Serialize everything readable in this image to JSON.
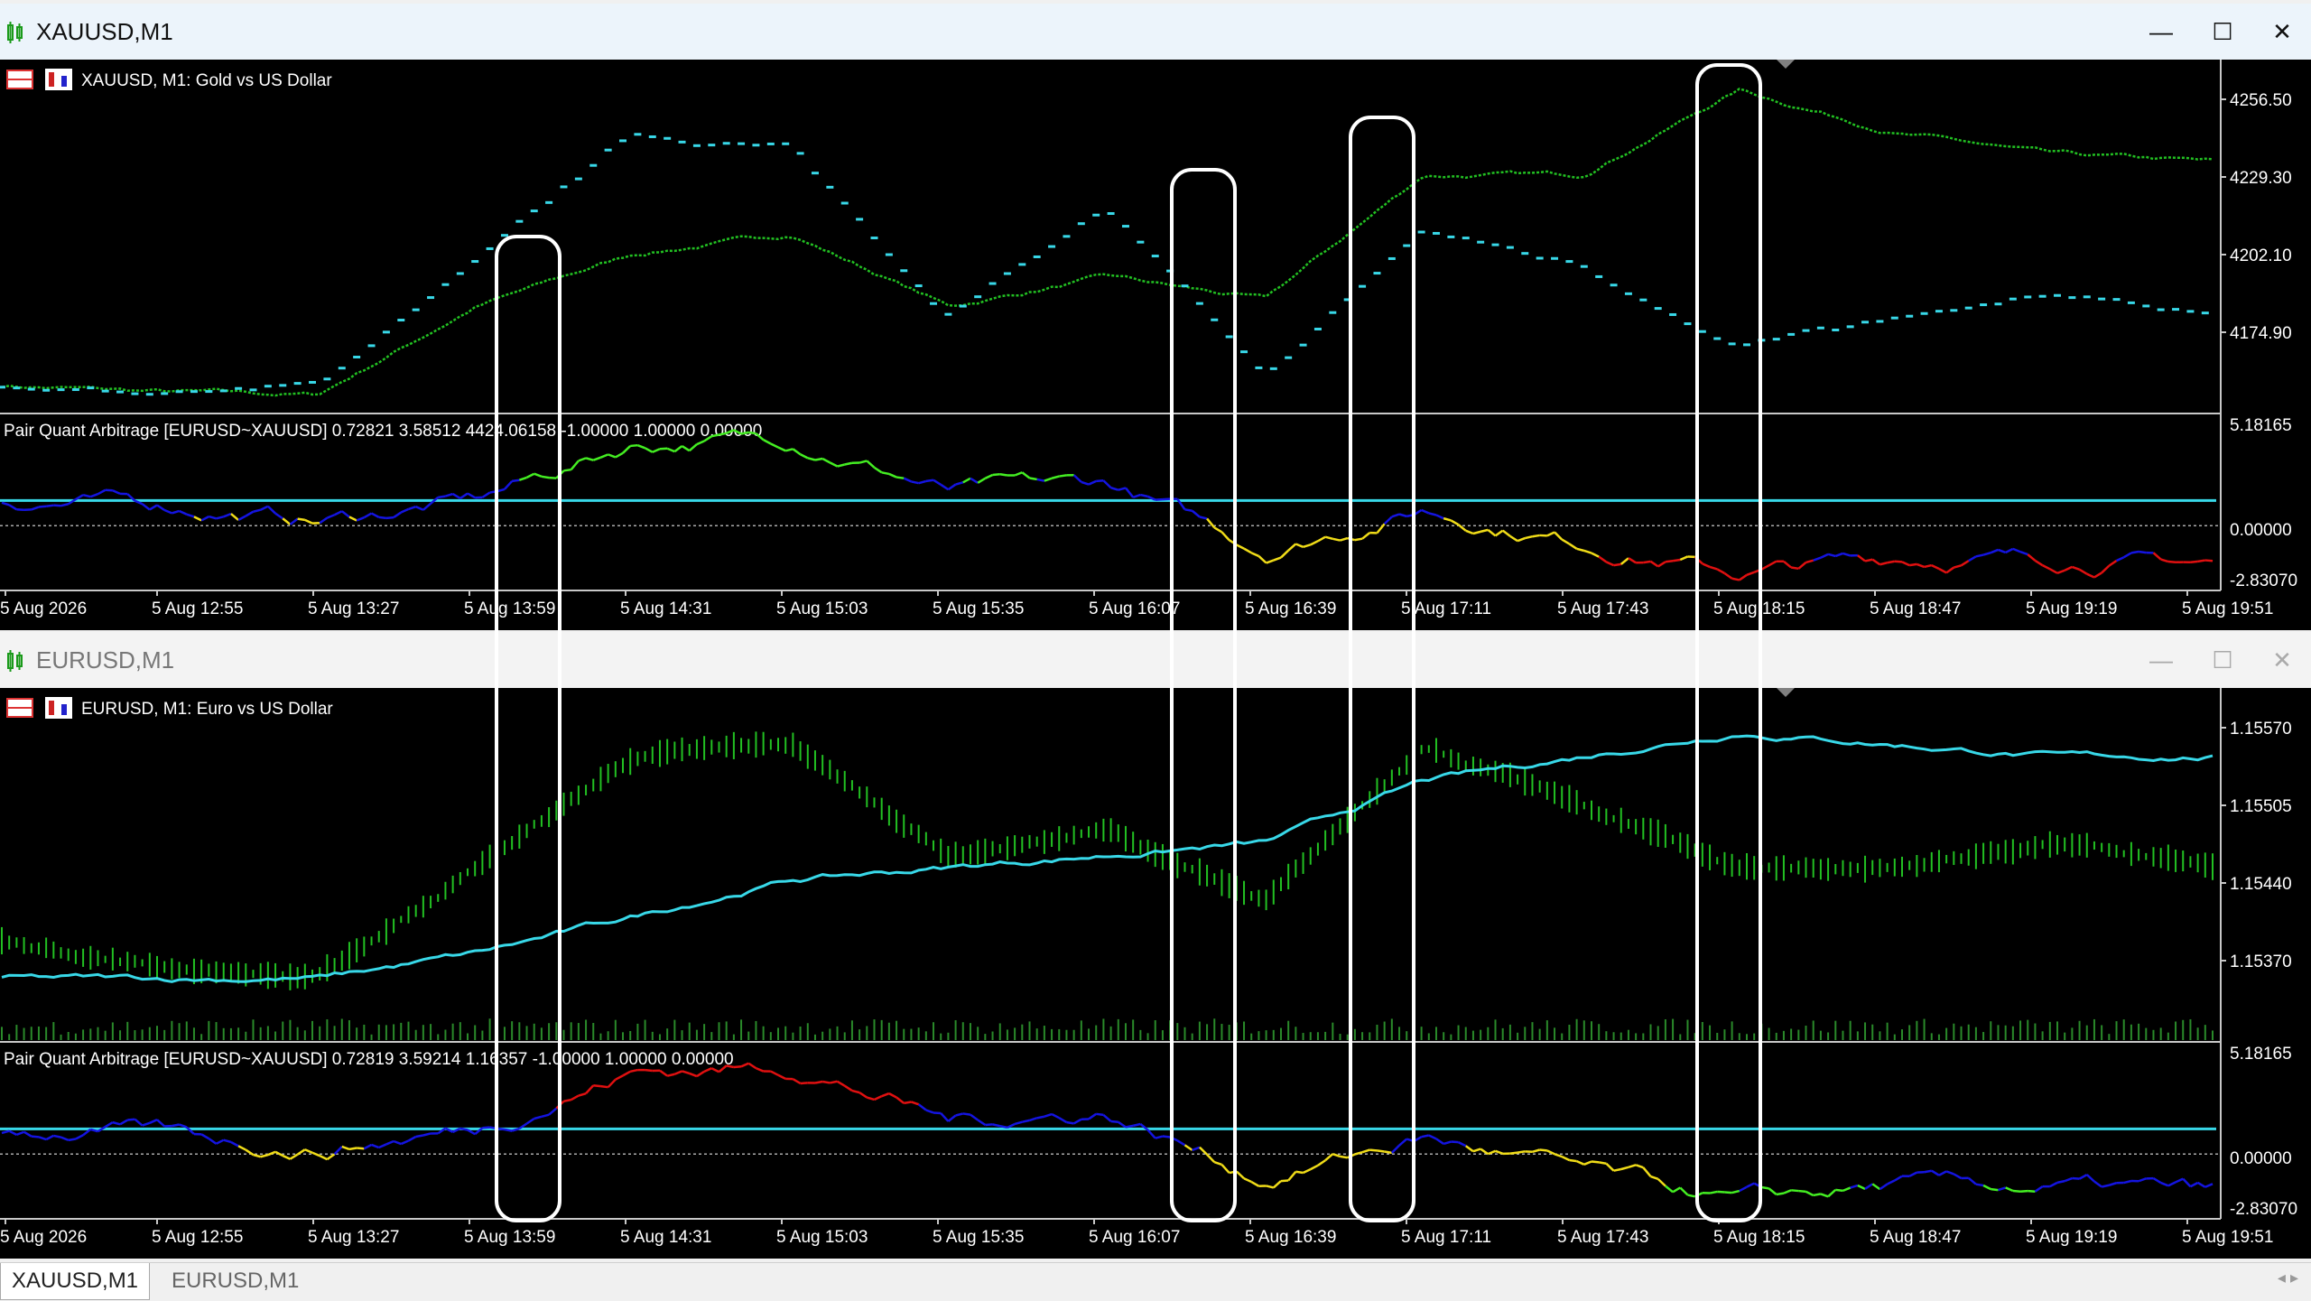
{
  "windows": [
    {
      "id": "w1",
      "title": "XAUUSD,M1",
      "chart_label": "XAUUSD, M1:  Gold vs US Dollar",
      "price_ticks": [
        "4256.50",
        "4229.30",
        "4202.10",
        "4174.90"
      ],
      "ind_label": "Pair Quant Arbitrage [EURUSD~XAUUSD] 0.72821 3.58512 4424.06158 -1.00000 1.00000 0.00000",
      "ind_ticks": [
        "5.18165",
        "0.00000",
        "-2.83070"
      ],
      "time_ticks": [
        "5 Aug 2026",
        "5 Aug 12:55",
        "5 Aug 13:27",
        "5 Aug 13:59",
        "5 Aug 14:31",
        "5 Aug 15:03",
        "5 Aug 15:35",
        "5 Aug 16:07",
        "5 Aug 16:39",
        "5 Aug 17:11",
        "5 Aug 17:43",
        "5 Aug 18:15",
        "5 Aug 18:47",
        "5 Aug 19:19",
        "5 Aug 19:51"
      ]
    },
    {
      "id": "w2",
      "title": "EURUSD,M1",
      "chart_label": "EURUSD, M1:  Euro vs US Dollar",
      "price_ticks": [
        "1.15570",
        "1.15505",
        "1.15440",
        "1.15370"
      ],
      "ind_label": "Pair Quant Arbitrage [EURUSD~XAUUSD] 0.72819 3.59214 1.16357 -1.00000 1.00000 0.00000",
      "ind_ticks": [
        "5.18165",
        "0.00000",
        "-2.83070"
      ],
      "time_ticks": [
        "5 Aug 2026",
        "5 Aug 12:55",
        "5 Aug 13:27",
        "5 Aug 13:59",
        "5 Aug 14:31",
        "5 Aug 15:03",
        "5 Aug 15:35",
        "5 Aug 16:07",
        "5 Aug 16:39",
        "5 Aug 17:11",
        "5 Aug 17:43",
        "5 Aug 18:15",
        "5 Aug 18:47",
        "5 Aug 19:19",
        "5 Aug 19:51"
      ]
    }
  ],
  "tabs": [
    {
      "label": "XAUUSD,M1",
      "active": true
    },
    {
      "label": "EURUSD,M1",
      "active": false
    }
  ],
  "title_buttons": {
    "minimize": "—",
    "maximize": "☐",
    "close": "✕"
  },
  "colors": {
    "green": "#22c022",
    "cyan": "#38d8e8",
    "blue": "#1414e0",
    "yellow": "#f0dc18",
    "red": "#e01010",
    "lime": "#44ee22"
  },
  "chart_data": [
    {
      "type": "line",
      "symbol": "XAUUSD",
      "timeframe": "M1",
      "title": "XAUUSD, M1:  Gold vs US Dollar",
      "x": [
        "5 Aug 2026",
        "5 Aug 12:55",
        "5 Aug 13:27",
        "5 Aug 13:59",
        "5 Aug 14:31",
        "5 Aug 15:03",
        "5 Aug 15:35",
        "5 Aug 16:07",
        "5 Aug 16:39",
        "5 Aug 17:11",
        "5 Aug 17:43",
        "5 Aug 18:15",
        "5 Aug 18:47",
        "5 Aug 19:19",
        "5 Aug 19:51"
      ],
      "series": [
        {
          "values": [
            4168,
            4166,
            4165,
            4192,
            4208,
            4214,
            4192,
            4201,
            4194,
            4232,
            4232,
            4258,
            4245,
            4238,
            4236
          ]
        },
        {
          "values": [
            4167,
            4166,
            4168,
            4205,
            4245,
            4240,
            4190,
            4222,
            4170,
            4215,
            4205,
            4180,
            4188,
            4195,
            4190
          ]
        }
      ],
      "ylim": [
        4160,
        4265
      ]
    },
    {
      "type": "line",
      "title": "Pair Quant Arbitrage [EURUSD~XAUUSD] 0.72821 3.58512 4424.06158 -1.00000 1.00000 0.00000",
      "x": [
        "5 Aug 2026",
        "5 Aug 12:55",
        "5 Aug 13:27",
        "5 Aug 13:59",
        "5 Aug 14:31",
        "5 Aug 15:03",
        "5 Aug 15:35",
        "5 Aug 16:07",
        "5 Aug 16:39",
        "5 Aug 17:11",
        "5 Aug 17:43",
        "5 Aug 18:15",
        "5 Aug 18:47",
        "5 Aug 19:19",
        "5 Aug 19:51"
      ],
      "series": [
        {
          "values": [
            1.2,
            1.0,
            0.2,
            1.2,
            3.9,
            4.2,
            1.6,
            2.0,
            -1.2,
            0.8,
            -0.8,
            -2.3,
            -1.5,
            -1.6,
            -1.8
          ]
        },
        {
          "values": [
            1.2,
            1.2,
            1.2,
            1.2,
            1.2,
            1.2,
            1.2,
            1.2,
            1.2,
            1.2,
            1.2,
            1.2,
            1.2,
            1.2,
            1.2
          ]
        }
      ],
      "ylim": [
        -2.8307,
        5.18165
      ]
    },
    {
      "type": "bar",
      "symbol": "EURUSD",
      "timeframe": "M1",
      "title": "EURUSD, M1:  Euro vs US Dollar",
      "x": [
        "5 Aug 2026",
        "5 Aug 12:55",
        "5 Aug 13:27",
        "5 Aug 13:59",
        "5 Aug 14:31",
        "5 Aug 15:03",
        "5 Aug 15:35",
        "5 Aug 16:07",
        "5 Aug 16:39",
        "5 Aug 17:11",
        "5 Aug 17:43",
        "5 Aug 18:15",
        "5 Aug 18:47",
        "5 Aug 19:19",
        "5 Aug 19:51"
      ],
      "series": [
        {
          "values": [
            1.154,
            1.1538,
            1.1537,
            1.1546,
            1.1555,
            1.1556,
            1.1547,
            1.1549,
            1.1543,
            1.1556,
            1.1551,
            1.1546,
            1.1546,
            1.1548,
            1.1546
          ]
        },
        {
          "values": [
            1.1537,
            1.1537,
            1.1537,
            1.1539,
            1.1542,
            1.1545,
            1.1546,
            1.1547,
            1.1548,
            1.1553,
            1.1555,
            1.1557,
            1.1556,
            1.1555,
            1.1555
          ]
        }
      ],
      "ylim": [
        1.1532,
        1.156
      ]
    },
    {
      "type": "line",
      "title": "Pair Quant Arbitrage [EURUSD~XAUUSD] 0.72819 3.59214 1.16357 -1.00000 1.00000 0.00000",
      "x": [
        "5 Aug 2026",
        "5 Aug 12:55",
        "5 Aug 13:27",
        "5 Aug 13:59",
        "5 Aug 14:31",
        "5 Aug 15:03",
        "5 Aug 15:35",
        "5 Aug 16:07",
        "5 Aug 16:39",
        "5 Aug 17:11",
        "5 Aug 17:43",
        "5 Aug 18:15",
        "5 Aug 18:47",
        "5 Aug 19:19",
        "5 Aug 19:51"
      ],
      "series": [
        {
          "values": [
            1.2,
            1.0,
            0.2,
            1.2,
            3.9,
            4.2,
            1.6,
            2.0,
            -1.2,
            0.8,
            -0.8,
            -2.3,
            -1.5,
            -1.6,
            -1.8
          ]
        },
        {
          "values": [
            1.2,
            1.2,
            1.2,
            1.2,
            1.2,
            1.2,
            1.2,
            1.2,
            1.2,
            1.2,
            1.2,
            1.2,
            1.2,
            1.2,
            1.2
          ]
        }
      ],
      "ylim": [
        -2.8307,
        5.18165
      ]
    }
  ]
}
